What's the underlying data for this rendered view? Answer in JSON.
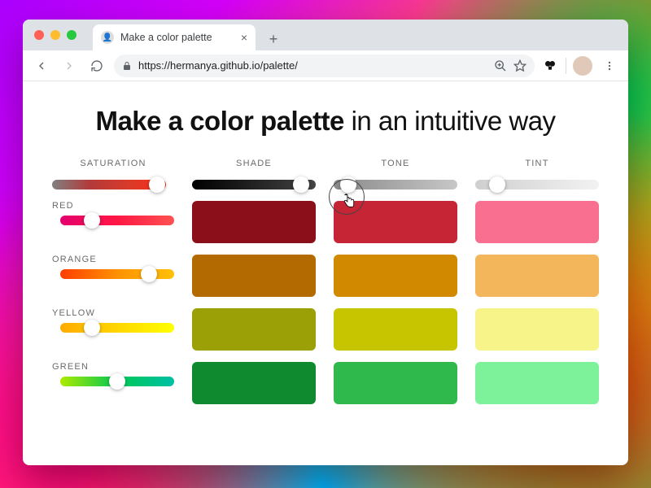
{
  "browser": {
    "tab_title": "Make a color palette",
    "url": "https://hermanya.github.io/palette/",
    "nav": {
      "back": "←",
      "forward": "→",
      "reload": "⟳"
    },
    "omni_icons": {
      "lock": "🔒",
      "zoom": "⊕",
      "star": "☆",
      "menu": "⋮"
    },
    "newtab": "+",
    "close": "×"
  },
  "page": {
    "heading_bold": "Make a color palette",
    "heading_rest": " in an intuitive way"
  },
  "columns": {
    "saturation": "SATURATION",
    "shade": "SHADE",
    "tone": "TONE",
    "tint": "TINT"
  },
  "sliders": {
    "saturation": {
      "gradient": "linear-gradient(90deg,#808080,#b33a3a,#d83a2a,#ff2e17)",
      "thumb_pct": 92
    },
    "shade": {
      "gradient": "linear-gradient(90deg,#000000,#444444)",
      "thumb_pct": 88
    },
    "tone": {
      "gradient": "linear-gradient(90deg,#8a8a8a,#c7c7c7)",
      "thumb_pct": 12
    },
    "tint": {
      "gradient": "linear-gradient(90deg,#cfcfcf,#f2f2f2)",
      "thumb_pct": 18
    }
  },
  "rows": [
    {
      "label": "RED",
      "hue_gradient": "linear-gradient(90deg,#e4006e,#ff1744,#ff5252)",
      "hue_thumb_pct": 28,
      "shade": "#8a0f1a",
      "tone": "#c62535",
      "tint": "#f96f8f"
    },
    {
      "label": "ORANGE",
      "hue_gradient": "linear-gradient(90deg,#ff3d00,#ff9100,#ffc107)",
      "hue_thumb_pct": 78,
      "shade": "#b36a00",
      "tone": "#d18a00",
      "tint": "#f4b65a"
    },
    {
      "label": "YELLOW",
      "hue_gradient": "linear-gradient(90deg,#ffab00,#ffd600,#ffff00)",
      "hue_thumb_pct": 28,
      "shade": "#9aa006",
      "tone": "#c7c400",
      "tint": "#f7f48a"
    },
    {
      "label": "GREEN",
      "hue_gradient": "linear-gradient(90deg,#aeea00,#00c853,#00bfa5)",
      "hue_thumb_pct": 50,
      "shade": "#0f8a2e",
      "tone": "#2fb84c",
      "tint": "#7ef29a"
    }
  ]
}
